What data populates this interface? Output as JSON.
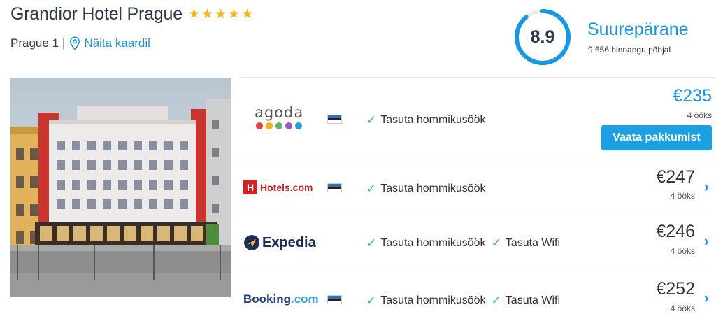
{
  "hotel": {
    "name": "Grandior Hotel Prague",
    "stars": [
      "★",
      "★",
      "★",
      "★",
      "★"
    ],
    "district": "Prague 1",
    "separator": "|",
    "map_link": "Näita kaardil"
  },
  "rating": {
    "score": "8.9",
    "label": "Suurepärane",
    "count_text": "9 656 hinnangu põhjal",
    "score_fraction": 0.89
  },
  "offers": [
    {
      "provider": "agoda",
      "logo_text": "agoda",
      "amenities": [
        "Tasuta hommikusöök"
      ],
      "price": "€235",
      "nights": "4 ööks",
      "button": "Vaata pakkumist",
      "best": true
    },
    {
      "provider": "hotels.com",
      "logo_text": "Hotels.com",
      "logo_mark": "H",
      "amenities": [
        "Tasuta hommikusöök"
      ],
      "price": "€247",
      "nights": "4 ööks",
      "chevron": "›"
    },
    {
      "provider": "expedia",
      "logo_text": "Expedia",
      "amenities": [
        "Tasuta hommikusöök",
        "Tasuta Wifi"
      ],
      "price": "€246",
      "nights": "4 ööks",
      "chevron": "›"
    },
    {
      "provider": "booking.com",
      "logo_text_main": "Booking",
      "logo_text_suffix": ".com",
      "amenities": [
        "Tasuta hommikusöök",
        "Tasuta Wifi"
      ],
      "price": "€252",
      "nights": "4 ööks",
      "chevron": "›"
    }
  ],
  "check_glyph": "✓",
  "colors": {
    "accent": "#1597e3",
    "button": "#1ba1e2",
    "check": "#3cbf86",
    "star": "#f7b520"
  }
}
